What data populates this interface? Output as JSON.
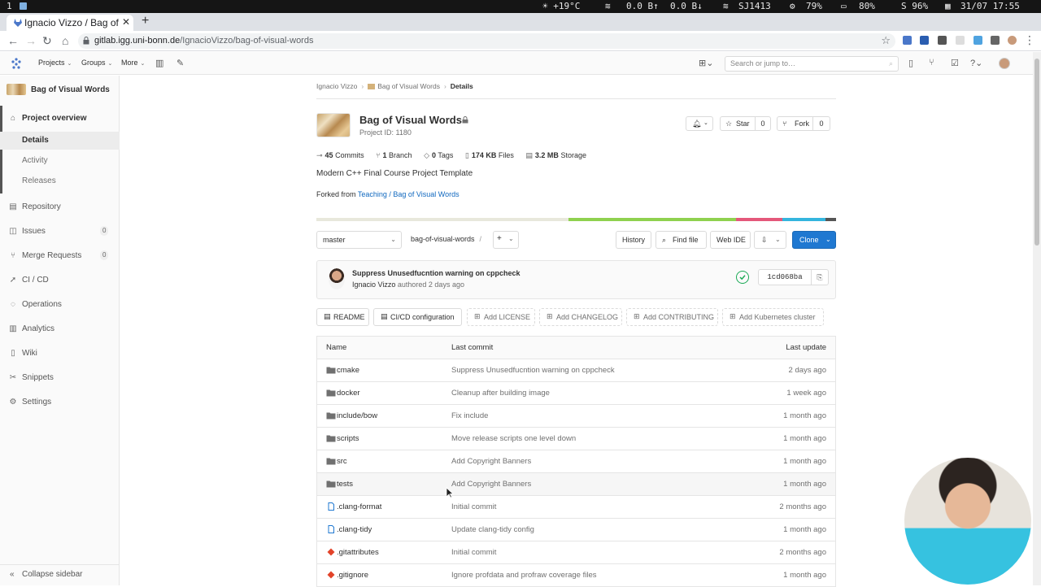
{
  "os_bar": {
    "workspace": "1",
    "weather": "☀ +19°C",
    "net_down": "0.0 B↑",
    "net_up": "0.0 B↓",
    "wifi": "SJ1413",
    "cpu": "79%",
    "battery": "80%",
    "s_value": "S 96%",
    "datetime": "31/07 17:55"
  },
  "browser": {
    "tab_title": "Ignacio Vizzo / Bag of Visual Words",
    "url_host": "gitlab.igg.uni-bonn.de",
    "url_path": "/IgnacioVizzo/bag-of-visual-words"
  },
  "topnav": {
    "projects": "Projects",
    "groups": "Groups",
    "more": "More",
    "search_placeholder": "Search or jump to…"
  },
  "sidebar": {
    "project_name": "Bag of Visual Words",
    "overview": "Project overview",
    "sub_items": [
      "Details",
      "Activity",
      "Releases"
    ],
    "items": [
      {
        "label": "Repository"
      },
      {
        "label": "Issues",
        "count": "0"
      },
      {
        "label": "Merge Requests",
        "count": "0"
      },
      {
        "label": "CI / CD"
      },
      {
        "label": "Operations"
      },
      {
        "label": "Analytics"
      },
      {
        "label": "Wiki"
      },
      {
        "label": "Snippets"
      },
      {
        "label": "Settings"
      }
    ],
    "collapse": "Collapse sidebar"
  },
  "breadcrumb": {
    "owner": "Ignacio Vizzo",
    "project": "Bag of Visual Words",
    "current": "Details"
  },
  "project": {
    "title": "Bag of Visual Words",
    "id_label": "Project ID: 1180",
    "star_label": "Star",
    "star_count": "0",
    "fork_label": "Fork",
    "fork_count": "0",
    "stats": {
      "commits_n": "45",
      "commits_l": "Commits",
      "branches_n": "1",
      "branches_l": "Branch",
      "tags_n": "0",
      "tags_l": "Tags",
      "files_n": "174 KB",
      "files_l": "Files",
      "storage_n": "3.2 MB",
      "storage_l": "Storage"
    },
    "description": "Modern C++ Final Course Project Template",
    "forked_prefix": "Forked from",
    "forked_link": "Teaching / Bag of Visual Words"
  },
  "language_colors": [
    "#e8e8dc",
    "#8fd14f",
    "#e4587a",
    "#34b5de",
    "#555555"
  ],
  "language_shares": [
    0.485,
    0.322,
    0.09,
    0.083,
    0.02
  ],
  "repo_controls": {
    "branch": "master",
    "path": "bag-of-visual-words",
    "path_sep": "/",
    "history": "History",
    "find_file": "Find file",
    "web_ide": "Web IDE",
    "clone": "Clone"
  },
  "last_commit": {
    "title": "Suppress Unusedfucntion warning on cppcheck",
    "author": "Ignacio Vizzo",
    "authored": "authored 2 days ago",
    "sha": "1cd068ba",
    "status_color": "#1aaa55"
  },
  "quick_buttons": [
    "README",
    "CI/CD configuration",
    "Add LICENSE",
    "Add CHANGELOG",
    "Add CONTRIBUTING",
    "Add Kubernetes cluster"
  ],
  "file_table": {
    "headers": [
      "Name",
      "Last commit",
      "Last update"
    ],
    "rows": [
      {
        "name": "cmake",
        "type": "folder",
        "msg": "Suppress Unusedfucntion warning on cppcheck",
        "date": "2 days ago"
      },
      {
        "name": "docker",
        "type": "folder",
        "msg": "Cleanup after building image",
        "date": "1 week ago"
      },
      {
        "name": "include/bow",
        "type": "folder",
        "msg": "Fix include",
        "date": "1 month ago"
      },
      {
        "name": "scripts",
        "type": "folder",
        "msg": "Move release scripts one level down",
        "date": "1 month ago"
      },
      {
        "name": "src",
        "type": "folder",
        "msg": "Add Copyright Banners",
        "date": "1 month ago"
      },
      {
        "name": "tests",
        "type": "folder",
        "msg": "Add Copyright Banners",
        "date": "1 month ago"
      },
      {
        "name": ".clang-format",
        "type": "file",
        "msg": "Initial commit",
        "date": "2 months ago"
      },
      {
        "name": ".clang-tidy",
        "type": "file",
        "msg": "Update clang-tidy config",
        "date": "1 month ago"
      },
      {
        "name": ".gitattributes",
        "type": "git",
        "msg": "Initial commit",
        "date": "2 months ago"
      },
      {
        "name": ".gitignore",
        "type": "git",
        "msg": "Ignore profdata and profraw coverage files",
        "date": "1 month ago"
      }
    ]
  }
}
